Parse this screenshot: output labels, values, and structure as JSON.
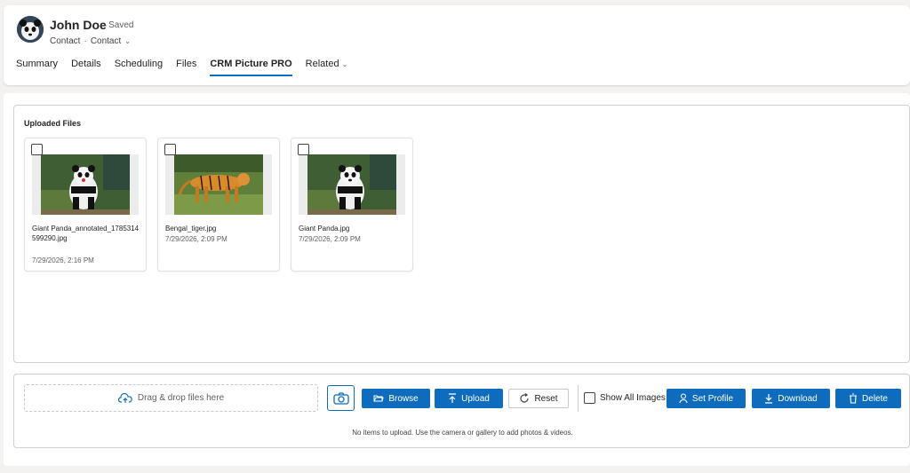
{
  "record": {
    "name": "John Doe",
    "status": "- Saved",
    "entity": "Contact",
    "separator": "·",
    "form": "Contact"
  },
  "tabs": [
    {
      "label": "Summary"
    },
    {
      "label": "Details"
    },
    {
      "label": "Scheduling"
    },
    {
      "label": "Files"
    },
    {
      "label": "CRM Picture PRO"
    },
    {
      "label": "Related"
    }
  ],
  "active_tab": "CRM Picture PRO",
  "uploaded": {
    "title": "Uploaded Files",
    "files": [
      {
        "name": "Giant Panda_annotated_1785314599290.jpg",
        "date": "7/29/2026, 2:16 PM",
        "subject": "panda"
      },
      {
        "name": "Bengal_tiger.jpg",
        "date": "7/29/2026, 2:09 PM",
        "subject": "tiger"
      },
      {
        "name": "Giant Panda.jpg",
        "date": "7/29/2026, 2:09 PM",
        "subject": "panda"
      }
    ]
  },
  "toolbar": {
    "dropzone_label": "Drag & drop files here",
    "browse_label": "Browse",
    "upload_label": "Upload",
    "reset_label": "Reset",
    "show_all_label": "Show All Images",
    "set_profile_label": "Set Profile",
    "download_label": "Download",
    "delete_label": "Delete",
    "hint": "No items to upload. Use the camera or gallery to add photos & videos."
  },
  "colors": {
    "accent": "#0f6cbd",
    "page_bg": "#f3f2f1"
  },
  "icons": [
    "cloud-upload-icon",
    "camera-icon",
    "folder-open-icon",
    "upload-icon",
    "reset-icon",
    "person-icon",
    "download-icon",
    "trash-icon",
    "chevron-down-icon"
  ]
}
